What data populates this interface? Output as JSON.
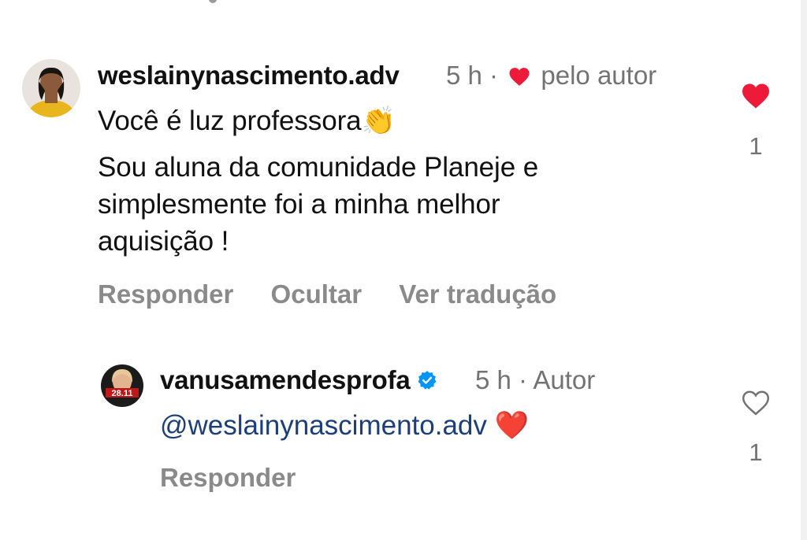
{
  "comments": [
    {
      "username": "weslainynascimento.adv",
      "time": "5 h ·",
      "liked_by_author_label": "pelo autor",
      "text_lines": [
        "Você é luz professora👏",
        "Sou aluna da comunidade Planeje e",
        "simplesmente foi a minha melhor",
        "aquisição !"
      ],
      "actions": [
        "Responder",
        "Ocultar",
        "Ver tradução"
      ],
      "like_count": "1",
      "liked": true,
      "like_color": "#ed1a3a"
    },
    {
      "username": "vanusamendesprofa",
      "time": "5 h · Autor",
      "mention": "@weslainynascimento.adv",
      "mention_emoji": "❤️",
      "actions": [
        "Responder"
      ],
      "like_count": "1",
      "liked": false,
      "avatar_badge": "28.11",
      "verified_color": "#0095f6"
    }
  ]
}
